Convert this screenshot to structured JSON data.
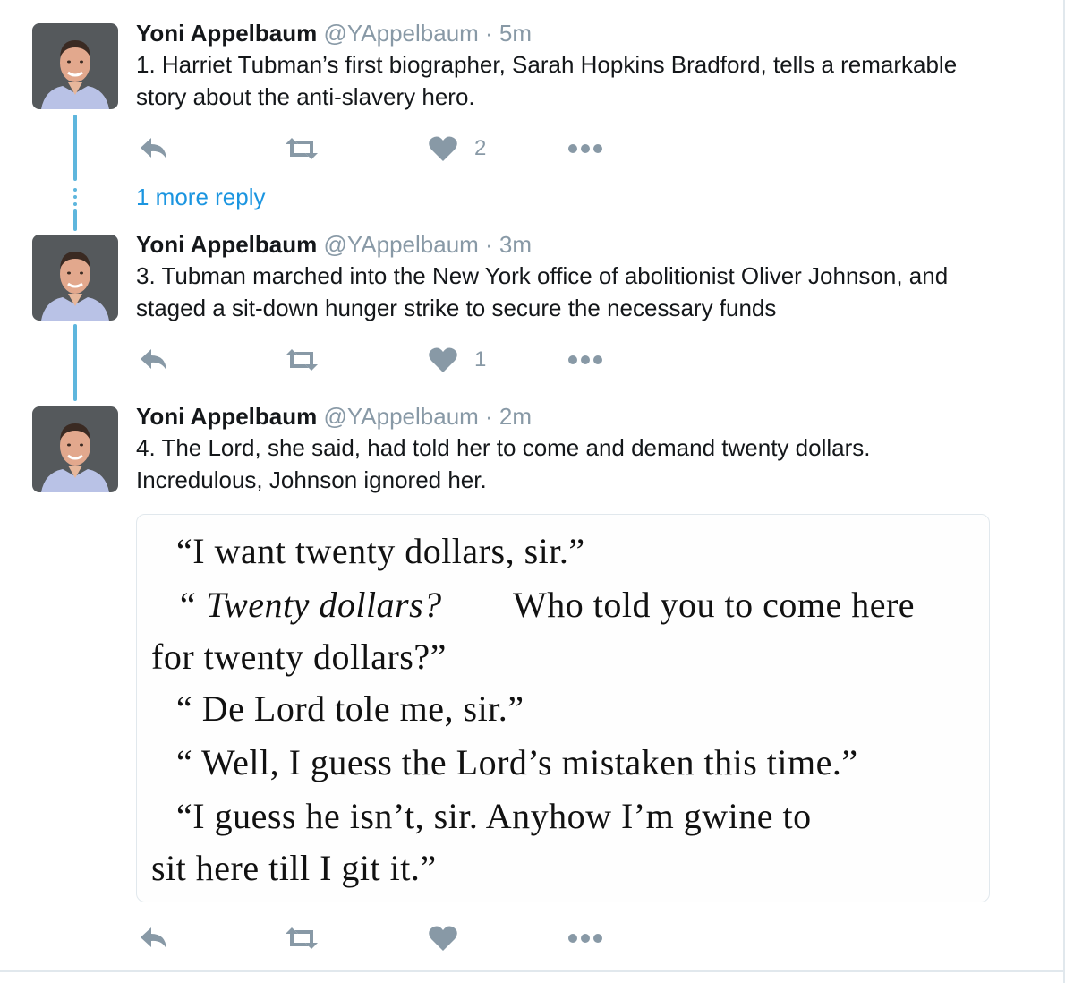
{
  "tweets": [
    {
      "name": "Yoni Appelbaum",
      "meta": "@YAppelbaum · 5m",
      "text_lines": [
        "1. Harriet Tubman’s first biographer, Sarah Hopkins Bradford, tells a remarkable",
        "story about the anti-slavery hero."
      ],
      "like_count": "2"
    },
    {
      "name": "Yoni Appelbaum",
      "meta": "@YAppelbaum · 3m",
      "text_lines": [
        "3. Tubman marched into the New York office of abolitionist Oliver Johnson, and",
        "staged a sit-down hunger strike to secure the necessary funds"
      ],
      "like_count": "1"
    },
    {
      "name": "Yoni Appelbaum",
      "meta": "@YAppelbaum · 2m",
      "text_lines": [
        "4. The Lord, she said, had told her to come and demand twenty dollars.",
        "Incredulous, Johnson ignored her."
      ],
      "like_count": ""
    }
  ],
  "more_reply_label": "1 more reply",
  "quote_image_lines": [
    "“I want twenty dollars, sir.”",
    "“ Twenty dollars?",
    "Who told you to come here",
    "for twenty dollars?”",
    "“ De Lord tole me, sir.”",
    "“ Well, I guess the Lord’s mistaken this time.”",
    "“I guess he isn’t, sir. Anyhow I’m gwine to",
    "sit here till I git it.”"
  ],
  "icons": [
    "reply-icon",
    "retweet-icon",
    "heart-icon",
    "more-icon"
  ],
  "colors": {
    "thread_line": "#5eb6dd",
    "link": "#1b95e0",
    "muted": "#8899a6"
  }
}
